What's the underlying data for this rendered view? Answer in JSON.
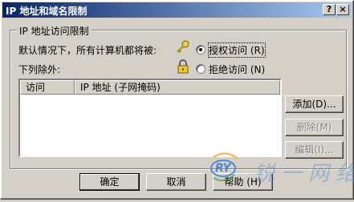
{
  "window": {
    "title": "IP 地址和域名限制",
    "help_button": "?",
    "close_button": "×"
  },
  "group": {
    "label": "IP 地址访问限制",
    "default_text": "默认情况下，所有计算机都将被:",
    "exceptions_text": "下列除外:",
    "options": [
      {
        "label": "授权访问 (R)",
        "selected": true
      },
      {
        "label": "拒绝访问 (N)",
        "selected": false
      }
    ],
    "icons": [
      "key-icon",
      "padlock-icon"
    ]
  },
  "list": {
    "columns": [
      "访问",
      "IP 地址 (子网掩码)"
    ],
    "rows": []
  },
  "side_buttons": [
    {
      "label": "添加(D)...",
      "enabled": true
    },
    {
      "label": "删除(M)",
      "enabled": false
    },
    {
      "label": "编辑(I)...",
      "enabled": false
    }
  ],
  "bottom_buttons": [
    {
      "label": "确定"
    },
    {
      "label": "取消"
    },
    {
      "label": "帮助 (H)"
    }
  ],
  "watermark": {
    "logo_text": "RY",
    "text": "锐一网络"
  },
  "colors": {
    "title_start": "#0a246a",
    "title_end": "#a6caf0",
    "face": "#d4d0c8",
    "watermark_blue": "#3a7fd0"
  }
}
